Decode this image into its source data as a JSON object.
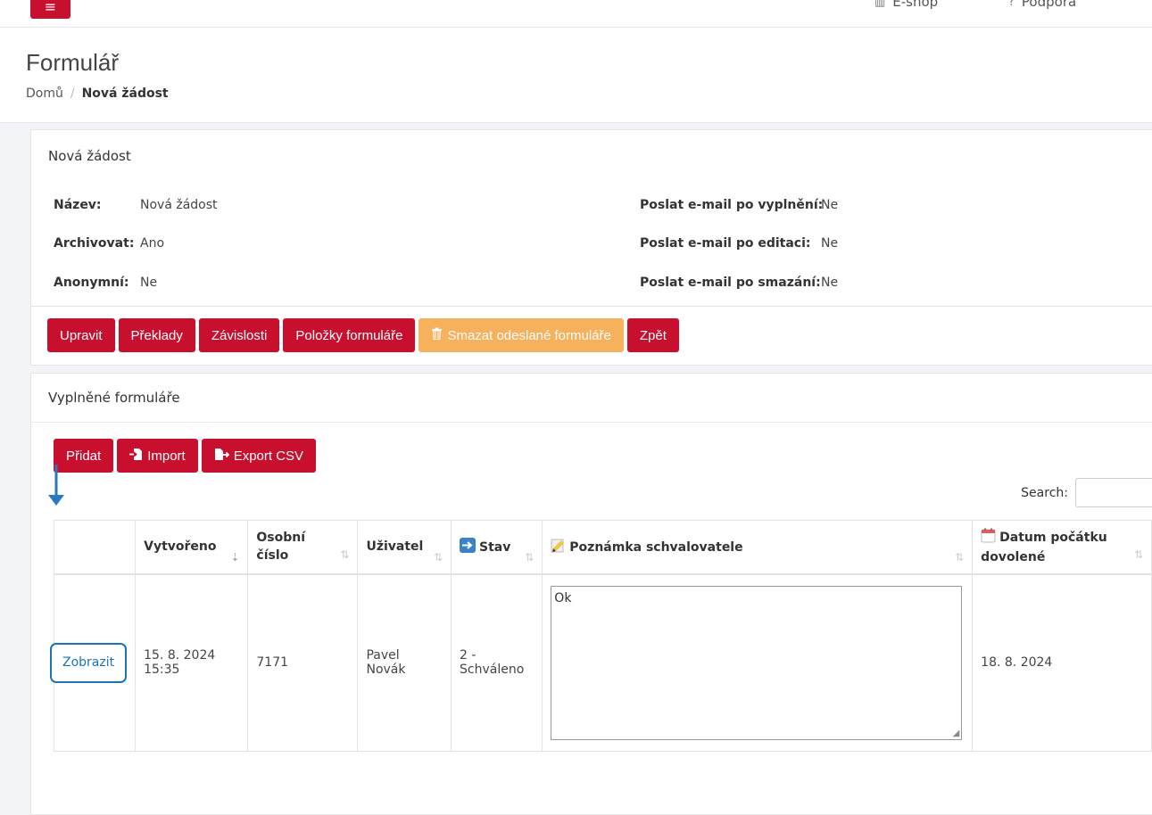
{
  "topbar": {
    "menu_icon": "hamburger-icon",
    "eshop_label": "E-shop",
    "support_label": "Podpora"
  },
  "page": {
    "title": "Formulář",
    "breadcrumb_home": "Domů",
    "breadcrumb_current": "Nová žádost"
  },
  "info": {
    "panel_title": "Nová žádost",
    "name_label": "Název:",
    "name_value": "Nová žádost",
    "archive_label": "Archivovat:",
    "archive_value": "Ano",
    "anon_label": "Anonymní:",
    "anon_value": "Ne",
    "email_fill_label": "Poslat e-mail po vyplnění:",
    "email_fill_value": "Ne",
    "email_edit_label": "Poslat e-mail po editaci:",
    "email_edit_value": "Ne",
    "email_delete_label": "Poslat e-mail po smazání:",
    "email_delete_value": "Ne"
  },
  "actions": {
    "edit": "Upravit",
    "translations": "Překlady",
    "dependencies": "Závislosti",
    "form_items": "Položky formuláře",
    "delete_submitted": "Smazat odeslané formuláře",
    "back": "Zpět"
  },
  "forms": {
    "panel_title": "Vyplněné formuláře",
    "add": "Přidat",
    "import": "Import",
    "export_csv": "Export CSV",
    "search_label": "Search:",
    "columns": [
      "",
      "Vytvořeno",
      "Osobní číslo",
      "Uživatel",
      "Stav",
      "Poznámka schvalovatele",
      "Datum počátku dovolené"
    ],
    "rows": [
      {
        "view": "Zobrazit",
        "created_date": "15. 8. 2024",
        "created_time": "15:35",
        "personal_number": "7171",
        "user": "Pavel Novák",
        "status_line1": "2 -",
        "status_line2": "Schváleno",
        "note": "Ok",
        "vacation_start": "18. 8. 2024"
      }
    ]
  },
  "colors": {
    "primary": "#c8102e",
    "warning": "#f7b05c",
    "link": "#1d74b5"
  }
}
